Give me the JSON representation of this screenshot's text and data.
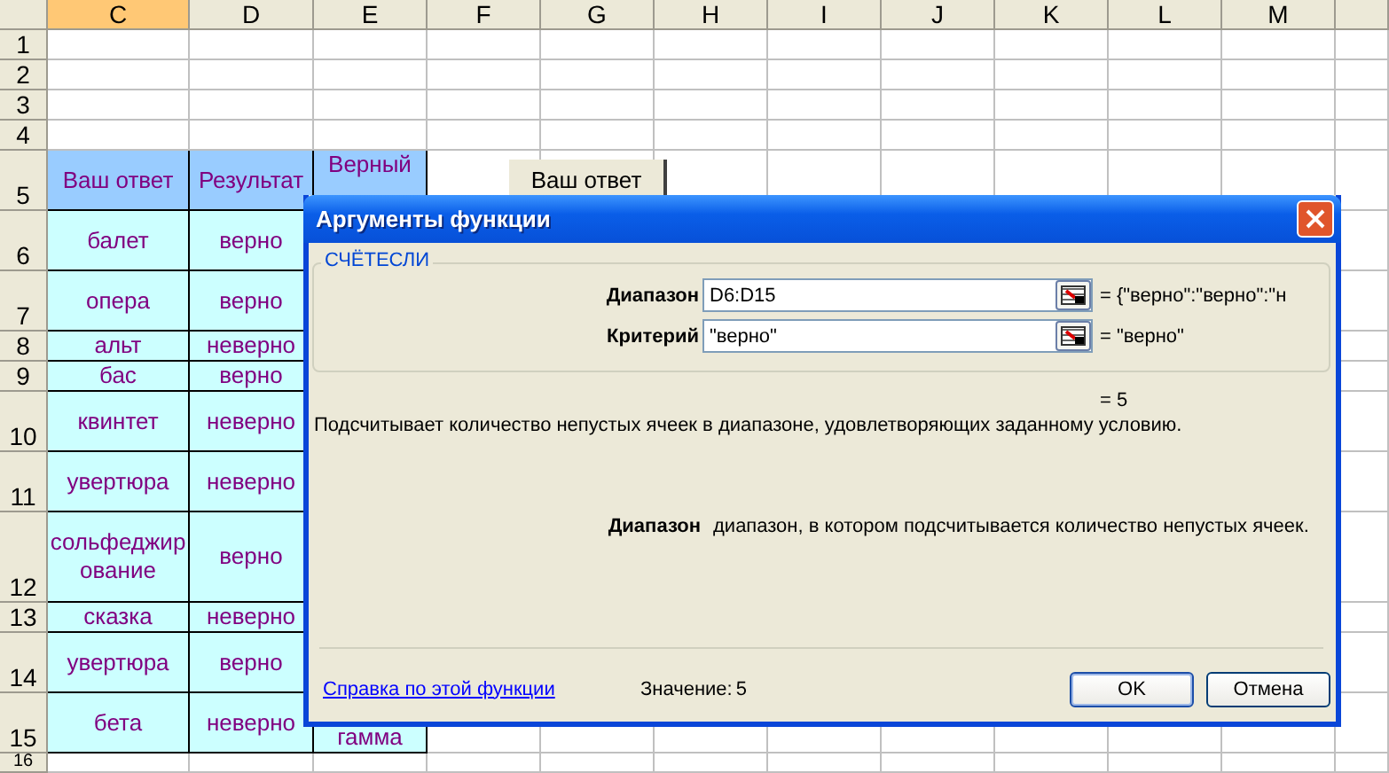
{
  "columns": [
    {
      "label": "C",
      "selected": true
    },
    {
      "label": "D",
      "selected": false
    },
    {
      "label": "E",
      "selected": false
    },
    {
      "label": "F",
      "selected": false
    },
    {
      "label": "G",
      "selected": false
    },
    {
      "label": "H",
      "selected": false
    },
    {
      "label": "I",
      "selected": false
    },
    {
      "label": "J",
      "selected": false
    },
    {
      "label": "K",
      "selected": false
    },
    {
      "label": "L",
      "selected": false
    },
    {
      "label": "M",
      "selected": false
    }
  ],
  "rows": [
    {
      "number": "1",
      "cells": []
    },
    {
      "number": "2",
      "cells": []
    },
    {
      "number": "3",
      "cells": []
    },
    {
      "number": "4",
      "cells": []
    },
    {
      "number": "5",
      "kind": "header",
      "cells": [
        "Ваш ответ",
        "Результат",
        "Верный"
      ]
    },
    {
      "number": "6",
      "kind": "data",
      "cells": [
        "балет",
        "верно",
        ""
      ]
    },
    {
      "number": "7",
      "kind": "data",
      "cells": [
        "опера",
        "верно",
        ""
      ]
    },
    {
      "number": "8",
      "kind": "data",
      "cells": [
        "альт",
        "неверно",
        ""
      ]
    },
    {
      "number": "9",
      "kind": "data",
      "cells": [
        "бас",
        "верно",
        ""
      ]
    },
    {
      "number": "10",
      "kind": "data",
      "cells": [
        "квинтет",
        "неверно",
        ""
      ]
    },
    {
      "number": "11",
      "kind": "data",
      "cells": [
        "увертюра",
        "неверно",
        ""
      ]
    },
    {
      "number": "12",
      "kind": "data",
      "cells": [
        "сольфеджирование",
        "верно",
        ""
      ]
    },
    {
      "number": "13",
      "kind": "data",
      "cells": [
        "сказка",
        "неверно",
        ""
      ]
    },
    {
      "number": "14",
      "kind": "data",
      "cells": [
        "увертюра",
        "верно",
        ""
      ]
    },
    {
      "number": "15",
      "kind": "data",
      "cells": [
        "бета",
        "неверно",
        "гамма"
      ]
    },
    {
      "number": "16",
      "cells": []
    }
  ],
  "sheet_button": {
    "label": "Ваш ответ"
  },
  "dialog": {
    "title": "Аргументы функции",
    "function_name": "СЧЁТЕСЛИ",
    "arguments": [
      {
        "label": "Диапазон",
        "value": "D6:D15",
        "result": "= {\"верно\":\"верно\":\"н"
      },
      {
        "label": "Критерий",
        "value": "\"верно\"",
        "result": "= \"верно\""
      }
    ],
    "formula_result": "= 5",
    "description": "Подсчитывает количество непустых ячеек в диапазоне, удовлетворяющих заданному условию.",
    "argument_help": {
      "label": "Диапазон",
      "text": "диапазон, в котором подсчитывается количество непустых ячеек."
    },
    "help_link": "Справка по этой функции",
    "value_label": "Значение:",
    "value": "5",
    "buttons": [
      {
        "label": "OK",
        "default": true
      },
      {
        "label": "Отмена",
        "default": false
      }
    ]
  }
}
